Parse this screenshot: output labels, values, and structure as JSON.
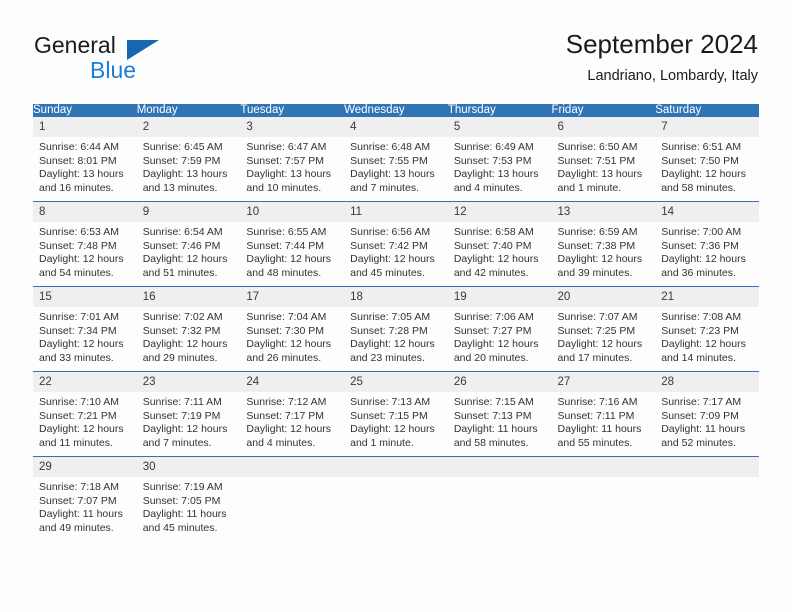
{
  "brand": {
    "name_part1": "General",
    "name_part2": "Blue",
    "triangle_color": "#1667b1",
    "blue_color": "#1a7fd4"
  },
  "header": {
    "title": "September 2024",
    "location": "Landriano, Lombardy, Italy"
  },
  "theme": {
    "header_blue": "#2f74b5",
    "daynum_gray": "#efefef",
    "text": "#333333"
  },
  "calendar": {
    "weekday_headers": [
      "Sunday",
      "Monday",
      "Tuesday",
      "Wednesday",
      "Thursday",
      "Friday",
      "Saturday"
    ],
    "weeks": [
      [
        {
          "day": "1",
          "sunrise": "Sunrise: 6:44 AM",
          "sunset": "Sunset: 8:01 PM",
          "daylight_line1": "Daylight: 13 hours",
          "daylight_line2": "and 16 minutes."
        },
        {
          "day": "2",
          "sunrise": "Sunrise: 6:45 AM",
          "sunset": "Sunset: 7:59 PM",
          "daylight_line1": "Daylight: 13 hours",
          "daylight_line2": "and 13 minutes."
        },
        {
          "day": "3",
          "sunrise": "Sunrise: 6:47 AM",
          "sunset": "Sunset: 7:57 PM",
          "daylight_line1": "Daylight: 13 hours",
          "daylight_line2": "and 10 minutes."
        },
        {
          "day": "4",
          "sunrise": "Sunrise: 6:48 AM",
          "sunset": "Sunset: 7:55 PM",
          "daylight_line1": "Daylight: 13 hours",
          "daylight_line2": "and 7 minutes."
        },
        {
          "day": "5",
          "sunrise": "Sunrise: 6:49 AM",
          "sunset": "Sunset: 7:53 PM",
          "daylight_line1": "Daylight: 13 hours",
          "daylight_line2": "and 4 minutes."
        },
        {
          "day": "6",
          "sunrise": "Sunrise: 6:50 AM",
          "sunset": "Sunset: 7:51 PM",
          "daylight_line1": "Daylight: 13 hours",
          "daylight_line2": "and 1 minute."
        },
        {
          "day": "7",
          "sunrise": "Sunrise: 6:51 AM",
          "sunset": "Sunset: 7:50 PM",
          "daylight_line1": "Daylight: 12 hours",
          "daylight_line2": "and 58 minutes."
        }
      ],
      [
        {
          "day": "8",
          "sunrise": "Sunrise: 6:53 AM",
          "sunset": "Sunset: 7:48 PM",
          "daylight_line1": "Daylight: 12 hours",
          "daylight_line2": "and 54 minutes."
        },
        {
          "day": "9",
          "sunrise": "Sunrise: 6:54 AM",
          "sunset": "Sunset: 7:46 PM",
          "daylight_line1": "Daylight: 12 hours",
          "daylight_line2": "and 51 minutes."
        },
        {
          "day": "10",
          "sunrise": "Sunrise: 6:55 AM",
          "sunset": "Sunset: 7:44 PM",
          "daylight_line1": "Daylight: 12 hours",
          "daylight_line2": "and 48 minutes."
        },
        {
          "day": "11",
          "sunrise": "Sunrise: 6:56 AM",
          "sunset": "Sunset: 7:42 PM",
          "daylight_line1": "Daylight: 12 hours",
          "daylight_line2": "and 45 minutes."
        },
        {
          "day": "12",
          "sunrise": "Sunrise: 6:58 AM",
          "sunset": "Sunset: 7:40 PM",
          "daylight_line1": "Daylight: 12 hours",
          "daylight_line2": "and 42 minutes."
        },
        {
          "day": "13",
          "sunrise": "Sunrise: 6:59 AM",
          "sunset": "Sunset: 7:38 PM",
          "daylight_line1": "Daylight: 12 hours",
          "daylight_line2": "and 39 minutes."
        },
        {
          "day": "14",
          "sunrise": "Sunrise: 7:00 AM",
          "sunset": "Sunset: 7:36 PM",
          "daylight_line1": "Daylight: 12 hours",
          "daylight_line2": "and 36 minutes."
        }
      ],
      [
        {
          "day": "15",
          "sunrise": "Sunrise: 7:01 AM",
          "sunset": "Sunset: 7:34 PM",
          "daylight_line1": "Daylight: 12 hours",
          "daylight_line2": "and 33 minutes."
        },
        {
          "day": "16",
          "sunrise": "Sunrise: 7:02 AM",
          "sunset": "Sunset: 7:32 PM",
          "daylight_line1": "Daylight: 12 hours",
          "daylight_line2": "and 29 minutes."
        },
        {
          "day": "17",
          "sunrise": "Sunrise: 7:04 AM",
          "sunset": "Sunset: 7:30 PM",
          "daylight_line1": "Daylight: 12 hours",
          "daylight_line2": "and 26 minutes."
        },
        {
          "day": "18",
          "sunrise": "Sunrise: 7:05 AM",
          "sunset": "Sunset: 7:28 PM",
          "daylight_line1": "Daylight: 12 hours",
          "daylight_line2": "and 23 minutes."
        },
        {
          "day": "19",
          "sunrise": "Sunrise: 7:06 AM",
          "sunset": "Sunset: 7:27 PM",
          "daylight_line1": "Daylight: 12 hours",
          "daylight_line2": "and 20 minutes."
        },
        {
          "day": "20",
          "sunrise": "Sunrise: 7:07 AM",
          "sunset": "Sunset: 7:25 PM",
          "daylight_line1": "Daylight: 12 hours",
          "daylight_line2": "and 17 minutes."
        },
        {
          "day": "21",
          "sunrise": "Sunrise: 7:08 AM",
          "sunset": "Sunset: 7:23 PM",
          "daylight_line1": "Daylight: 12 hours",
          "daylight_line2": "and 14 minutes."
        }
      ],
      [
        {
          "day": "22",
          "sunrise": "Sunrise: 7:10 AM",
          "sunset": "Sunset: 7:21 PM",
          "daylight_line1": "Daylight: 12 hours",
          "daylight_line2": "and 11 minutes."
        },
        {
          "day": "23",
          "sunrise": "Sunrise: 7:11 AM",
          "sunset": "Sunset: 7:19 PM",
          "daylight_line1": "Daylight: 12 hours",
          "daylight_line2": "and 7 minutes."
        },
        {
          "day": "24",
          "sunrise": "Sunrise: 7:12 AM",
          "sunset": "Sunset: 7:17 PM",
          "daylight_line1": "Daylight: 12 hours",
          "daylight_line2": "and 4 minutes."
        },
        {
          "day": "25",
          "sunrise": "Sunrise: 7:13 AM",
          "sunset": "Sunset: 7:15 PM",
          "daylight_line1": "Daylight: 12 hours",
          "daylight_line2": "and 1 minute."
        },
        {
          "day": "26",
          "sunrise": "Sunrise: 7:15 AM",
          "sunset": "Sunset: 7:13 PM",
          "daylight_line1": "Daylight: 11 hours",
          "daylight_line2": "and 58 minutes."
        },
        {
          "day": "27",
          "sunrise": "Sunrise: 7:16 AM",
          "sunset": "Sunset: 7:11 PM",
          "daylight_line1": "Daylight: 11 hours",
          "daylight_line2": "and 55 minutes."
        },
        {
          "day": "28",
          "sunrise": "Sunrise: 7:17 AM",
          "sunset": "Sunset: 7:09 PM",
          "daylight_line1": "Daylight: 11 hours",
          "daylight_line2": "and 52 minutes."
        }
      ],
      [
        {
          "day": "29",
          "sunrise": "Sunrise: 7:18 AM",
          "sunset": "Sunset: 7:07 PM",
          "daylight_line1": "Daylight: 11 hours",
          "daylight_line2": "and 49 minutes."
        },
        {
          "day": "30",
          "sunrise": "Sunrise: 7:19 AM",
          "sunset": "Sunset: 7:05 PM",
          "daylight_line1": "Daylight: 11 hours",
          "daylight_line2": "and 45 minutes."
        },
        {
          "day": "",
          "sunrise": "",
          "sunset": "",
          "daylight_line1": "",
          "daylight_line2": ""
        },
        {
          "day": "",
          "sunrise": "",
          "sunset": "",
          "daylight_line1": "",
          "daylight_line2": ""
        },
        {
          "day": "",
          "sunrise": "",
          "sunset": "",
          "daylight_line1": "",
          "daylight_line2": ""
        },
        {
          "day": "",
          "sunrise": "",
          "sunset": "",
          "daylight_line1": "",
          "daylight_line2": ""
        },
        {
          "day": "",
          "sunrise": "",
          "sunset": "",
          "daylight_line1": "",
          "daylight_line2": ""
        }
      ]
    ]
  }
}
